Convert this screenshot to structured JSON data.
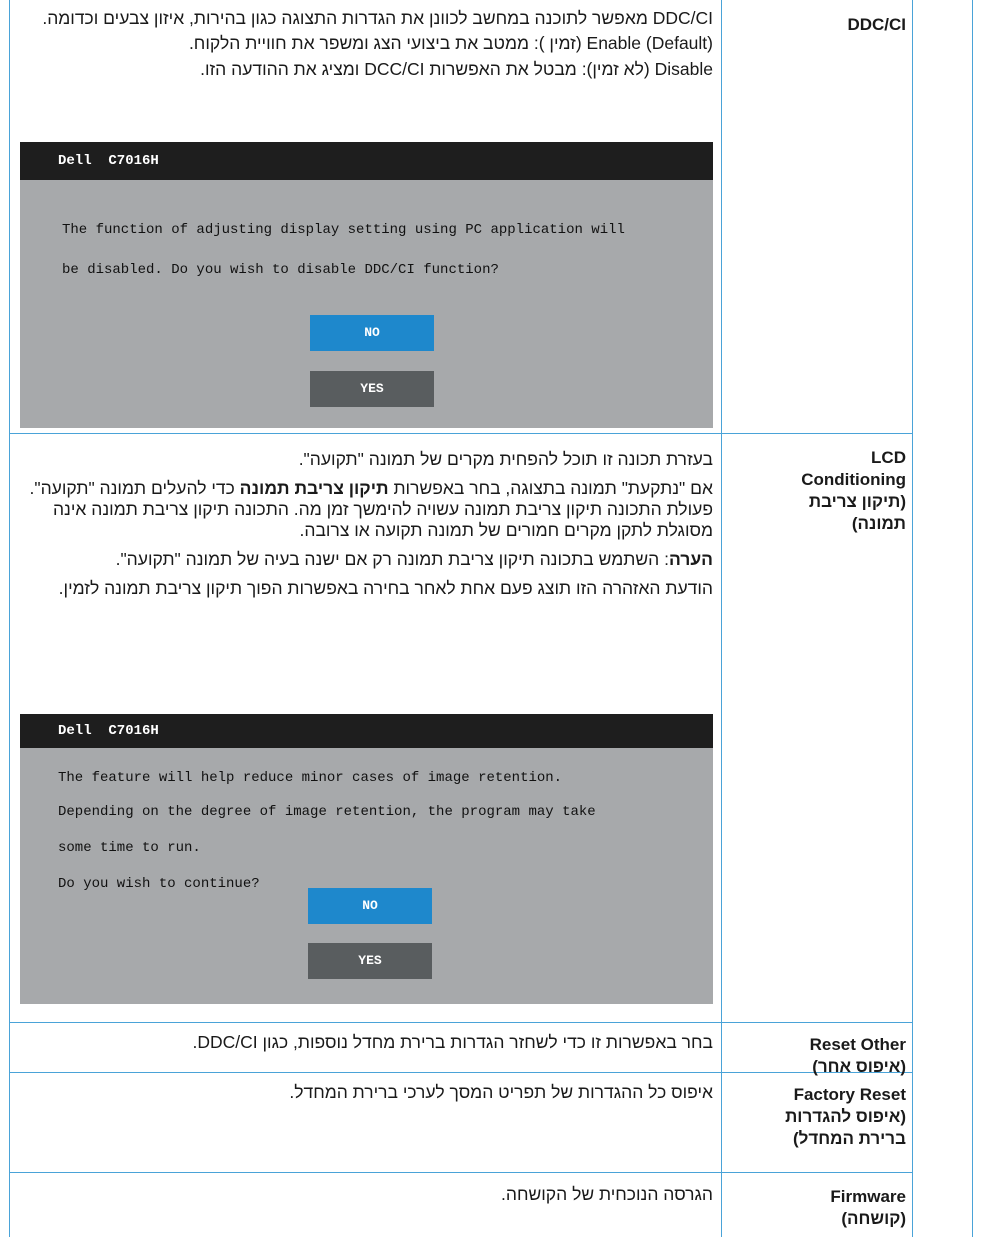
{
  "rows": {
    "ddcci": {
      "label": "DDC/CI",
      "desc_p1": "DDC/CI מאפשר לתוכנה במחשב לכוונן את הגדרות התצוגה כגון בהירות, איזון צבעים וכדומה.",
      "desc_p2": "Enable (Default) (זמין ): ממטב את ביצועי הצג ומשפר את חוויית הלקוח.",
      "desc_p3": "Disable (לא זמין): מבטל את האפשרות DCC/CI ומציג את ההודעה הזו.",
      "osd": {
        "title": "Dell  C7016H",
        "line1": "The function of adjusting display setting using PC application will",
        "line2": "be disabled. Do you wish to disable DDC/CI function?",
        "no_label": "NO",
        "yes_label": "YES"
      }
    },
    "lcd": {
      "label_l1": "LCD",
      "label_l2": "Conditioning",
      "label_l3": "(תיקון צריבת",
      "label_l4": "תמונה)",
      "desc_p1": "בעזרת תכונה זו תוכל להפחית מקרים של תמונה \"תקועה\".",
      "desc_p2_a": "אם \"נתקעת\" תמונה בתצוגה, בחר באפשרות",
      "desc_p2_b": "תיקון צריבת תמונה",
      "desc_p2_c": "כדי להעלים תמונה \"תקועה\". פעולת התכונה  תיקון צריבת תמונה עשויה להימשך זמן מה. התכונה  תיקון צריבת תמונה אינה מסוגלת לתקן מקרים חמורים של תמונה תקועה או צרובה.",
      "desc_p3_a": "הערה",
      "desc_p3_b": ": השתמש בתכונה  תיקון צריבת תמונה רק אם ישנה בעיה של תמונה \"תקועה\".",
      "desc_p4": "הודעת האזהרה הזו תוצג פעם אחת לאחר בחירה באפשרות הפוך תיקון צריבת תמונה לזמין.",
      "osd": {
        "title": "Dell  C7016H",
        "line1": "The feature will help reduce minor cases of image retention.",
        "line2": "Depending on the degree of image retention, the program may take",
        "line3": "some time to run.",
        "line4": "Do you wish to continue?",
        "no_label": "NO",
        "yes_label": "YES"
      }
    },
    "reset_other": {
      "label_l1": "Reset Other",
      "label_l2": "(איפוס אחר)",
      "desc": "בחר באפשרות זו כדי לשחזר הגדרות ברירת מחדל נוספות, כגון DDC/CI."
    },
    "factory_reset": {
      "label_l1": "Factory Reset",
      "label_l2": "(איפוס להגדרות",
      "label_l3": "ברירת המחדל)",
      "desc": "איפוס כל ההגדרות של תפריט המסך לערכי ברירת המחדל."
    },
    "firmware": {
      "label_l1": "Firmware",
      "label_l2": "(קושחה)",
      "desc": "הגרסה הנוכחית של הקושחה."
    }
  },
  "colors": {
    "grid": "#4aa3d8",
    "osd_bg": "#a7a9ab",
    "osd_bar": "#1e1e1e",
    "no_button": "#1e88cc",
    "yes_button": "#595d5f"
  }
}
